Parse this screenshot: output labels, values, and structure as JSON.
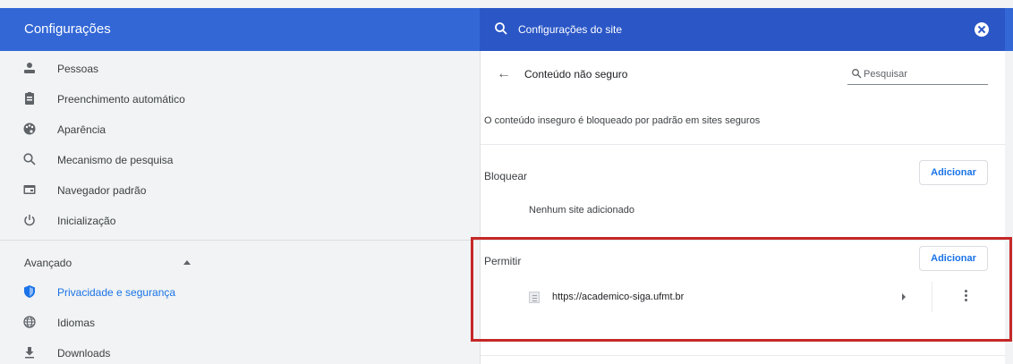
{
  "header": {
    "title": "Configurações",
    "search_value": "Configurações do site"
  },
  "sidebar": {
    "items": [
      {
        "label": "Pessoas",
        "icon": "person-icon"
      },
      {
        "label": "Preenchimento automático",
        "icon": "clipboard-icon"
      },
      {
        "label": "Aparência",
        "icon": "palette-icon"
      },
      {
        "label": "Mecanismo de pesquisa",
        "icon": "search-icon"
      },
      {
        "label": "Navegador padrão",
        "icon": "browser-icon"
      },
      {
        "label": "Inicialização",
        "icon": "power-icon"
      }
    ],
    "advanced_label": "Avançado",
    "advanced_items": [
      {
        "label": "Privacidade e segurança",
        "icon": "shield-icon",
        "active": true
      },
      {
        "label": "Idiomas",
        "icon": "globe-icon"
      },
      {
        "label": "Downloads",
        "icon": "download-icon"
      }
    ]
  },
  "main": {
    "page_title": "Conteúdo não seguro",
    "search_placeholder": "Pesquisar",
    "description": "O conteúdo inseguro é bloqueado por padrão em sites seguros",
    "block": {
      "title": "Bloquear",
      "add_label": "Adicionar",
      "empty_text": "Nenhum site adicionado"
    },
    "allow": {
      "title": "Permitir",
      "add_label": "Adicionar",
      "sites": [
        {
          "url": "https://academico-siga.ufmt.br"
        }
      ]
    }
  },
  "colors": {
    "header_bg": "#3367d6",
    "accent": "#1a73e8",
    "highlight_border": "#c62828"
  }
}
